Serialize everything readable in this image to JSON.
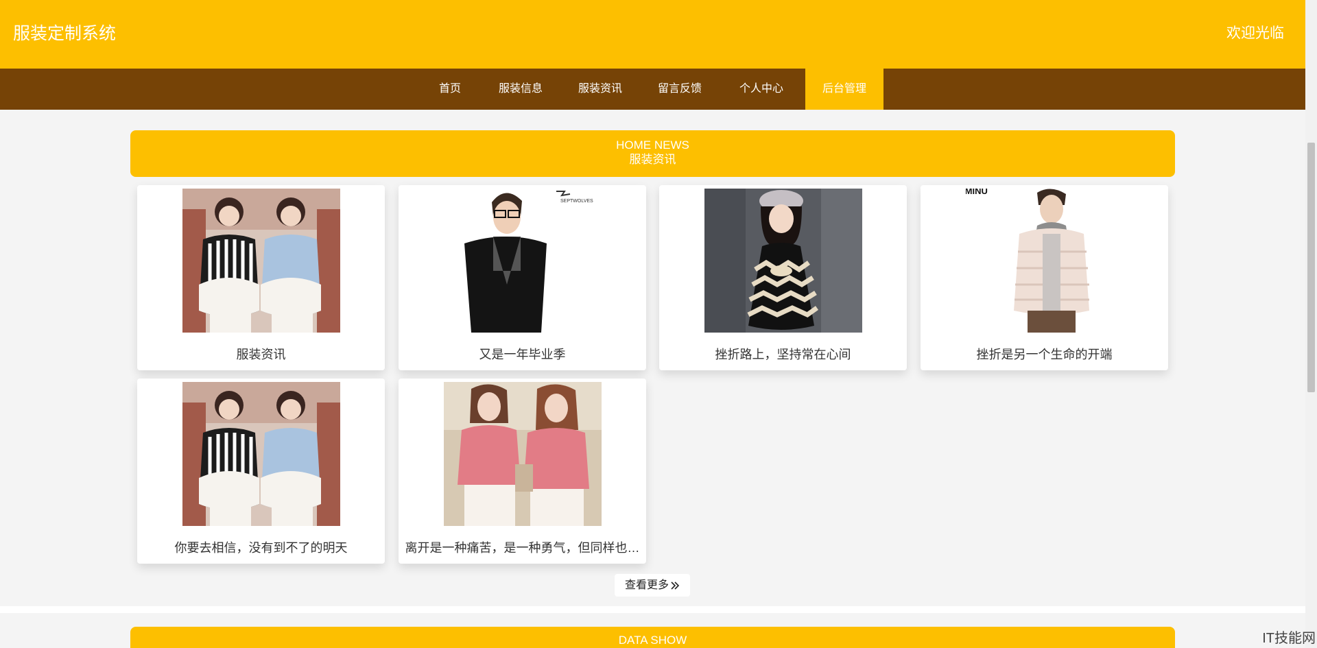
{
  "header": {
    "site_title": "服装定制系统",
    "welcome": "欢迎光临"
  },
  "nav": {
    "items": [
      {
        "label": "首页",
        "active": false
      },
      {
        "label": "服装信息",
        "active": false
      },
      {
        "label": "服装资讯",
        "active": false
      },
      {
        "label": "留言反馈",
        "active": false
      },
      {
        "label": "个人中心",
        "active": false
      },
      {
        "label": "后台管理",
        "active": true
      }
    ]
  },
  "news_section": {
    "title_en": "HOME NEWS",
    "title_cn": "服装资讯",
    "cards": [
      {
        "title": "服装资讯",
        "image": "two-women-lace-tops-photo"
      },
      {
        "title": "又是一年毕业季",
        "image": "man-black-coat-photo",
        "image_logo": "SEPTWOLVES"
      },
      {
        "title": "挫折路上，坚持常在心间",
        "image": "girl-patterned-dress-photo"
      },
      {
        "title": "挫折是另一个生命的开端",
        "image": "man-puffer-jacket-photo",
        "image_logo": "EMINU"
      },
      {
        "title": "你要去相信，没有到不了的明天",
        "image": "two-women-lace-tops-photo"
      },
      {
        "title": "离开是一种痛苦，是一种勇气，但同样也…",
        "image": "two-women-pink-tshirts-photo"
      }
    ],
    "more_button": "查看更多"
  },
  "data_section": {
    "title_en": "DATA SHOW"
  },
  "watermark": "IT技能网",
  "colors": {
    "primary": "#fdbf00",
    "nav_background": "#764306",
    "page_background": "#f4f4f4"
  }
}
